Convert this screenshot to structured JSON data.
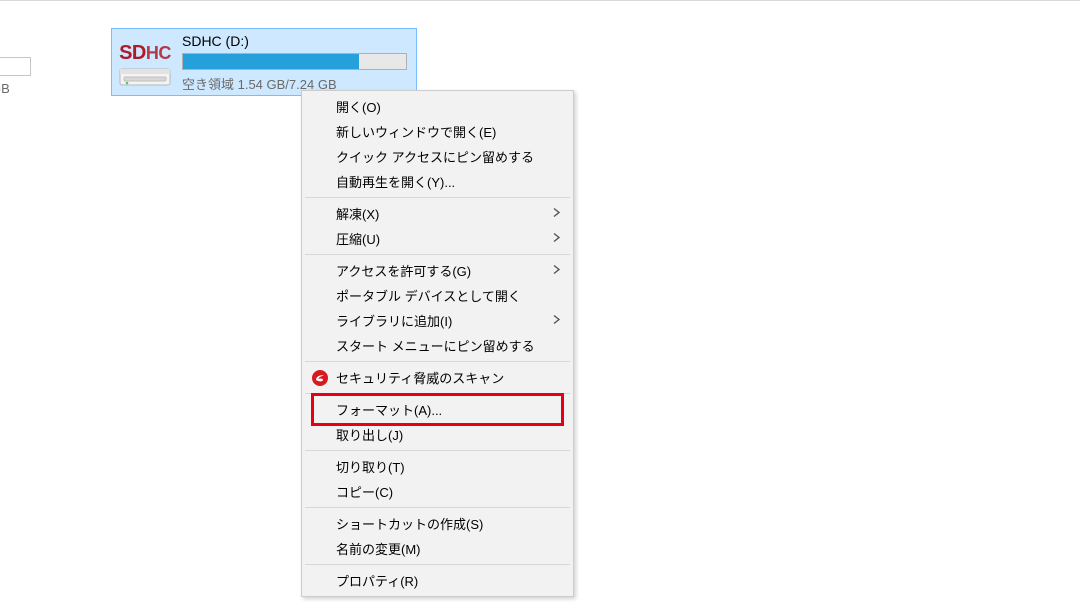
{
  "partial_tile": {
    "gb_text": "GB"
  },
  "drive": {
    "icon_label_sd": "SD",
    "icon_label_hc": "HC",
    "name": "SDHC (D:)",
    "free_label": "空き領域 1.54 GB/7.24 GB",
    "fill_percent": 79
  },
  "menu": {
    "items": [
      {
        "label": "開く(O)",
        "submenu": false,
        "sep_after": false
      },
      {
        "label": "新しいウィンドウで開く(E)",
        "submenu": false,
        "sep_after": false
      },
      {
        "label": "クイック アクセスにピン留めする",
        "submenu": false,
        "sep_after": false
      },
      {
        "label": "自動再生を開く(Y)...",
        "submenu": false,
        "sep_after": true
      },
      {
        "label": "解凍(X)",
        "submenu": true,
        "sep_after": false
      },
      {
        "label": "圧縮(U)",
        "submenu": true,
        "sep_after": true
      },
      {
        "label": "アクセスを許可する(G)",
        "submenu": true,
        "sep_after": false
      },
      {
        "label": "ポータブル デバイスとして開く",
        "submenu": false,
        "sep_after": false
      },
      {
        "label": "ライブラリに追加(I)",
        "submenu": true,
        "sep_after": false
      },
      {
        "label": "スタート メニューにピン留めする",
        "submenu": false,
        "sep_after": true
      },
      {
        "label": "セキュリティ脅威のスキャン",
        "submenu": false,
        "sep_after": true,
        "icon": "trend-icon"
      },
      {
        "label": "フォーマット(A)...",
        "submenu": false,
        "sep_after": false,
        "highlight": true
      },
      {
        "label": "取り出し(J)",
        "submenu": false,
        "sep_after": true
      },
      {
        "label": "切り取り(T)",
        "submenu": false,
        "sep_after": false
      },
      {
        "label": "コピー(C)",
        "submenu": false,
        "sep_after": true
      },
      {
        "label": "ショートカットの作成(S)",
        "submenu": false,
        "sep_after": false
      },
      {
        "label": "名前の変更(M)",
        "submenu": false,
        "sep_after": true
      },
      {
        "label": "プロパティ(R)",
        "submenu": false,
        "sep_after": false
      }
    ]
  }
}
